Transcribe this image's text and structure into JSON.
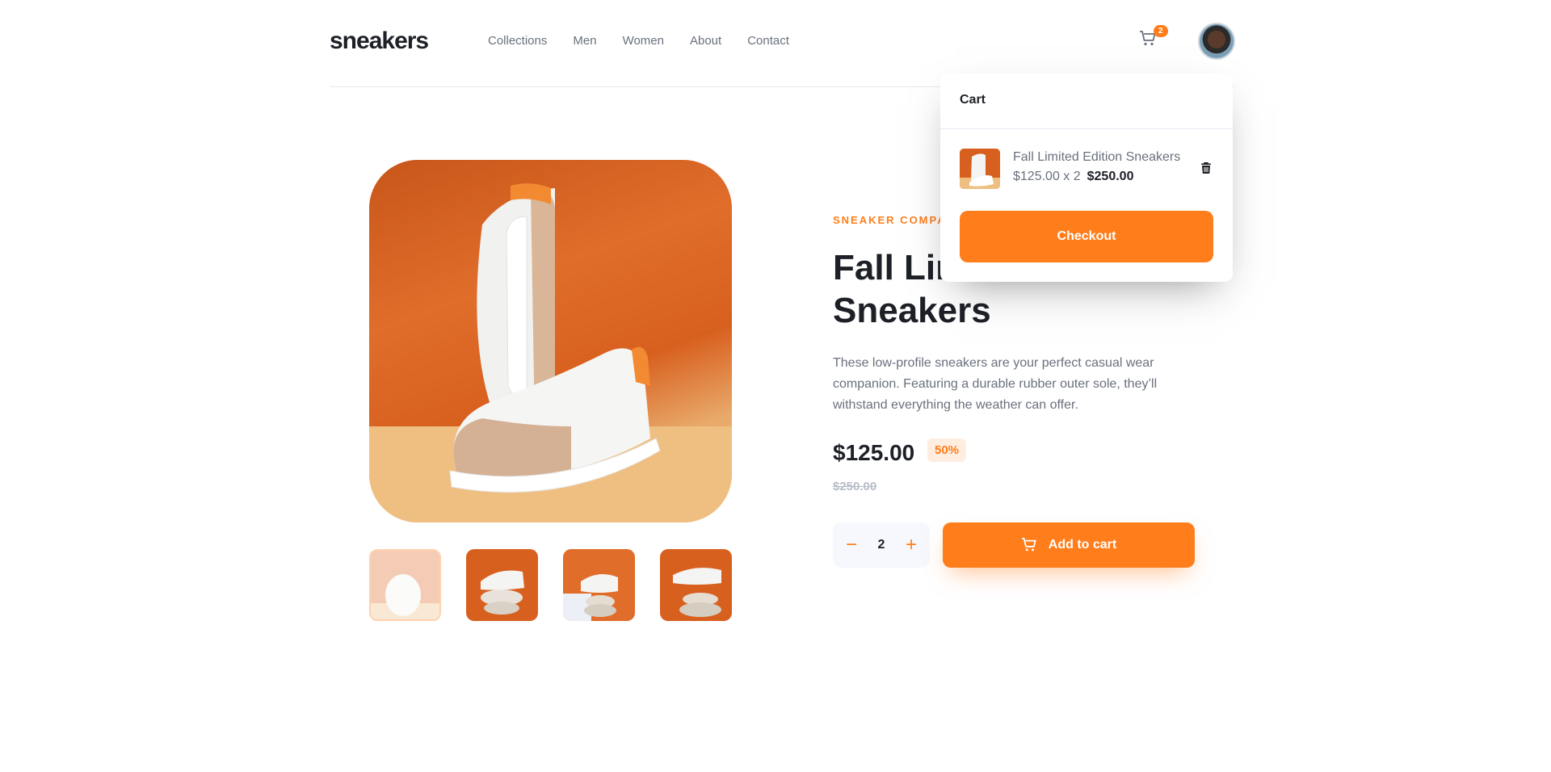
{
  "header": {
    "logo": "sneakers",
    "nav": [
      "Collections",
      "Men",
      "Women",
      "About",
      "Contact"
    ],
    "cart_count": "2"
  },
  "product": {
    "company": "SNEAKER COMPANY",
    "title": "Fall Limited Edition Sneakers",
    "description": "These low-profile sneakers are your perfect casual wear companion. Featuring a durable rubber outer sole, they’ll withstand everything the weather can offer.",
    "price": "$125.00",
    "discount": "50%",
    "old_price": "$250.00",
    "quantity": "2",
    "add_to_cart_label": "Add to cart"
  },
  "cart": {
    "title": "Cart",
    "item_name": "Fall Limited Edition Sneakers",
    "item_calc": "$125.00 x 2",
    "item_total": "$250.00",
    "checkout_label": "Checkout"
  },
  "colors": {
    "accent": "#ff7e1b",
    "accent_pale": "#ffede0",
    "text_dark": "#1d2026",
    "text_gray": "#69707d"
  }
}
